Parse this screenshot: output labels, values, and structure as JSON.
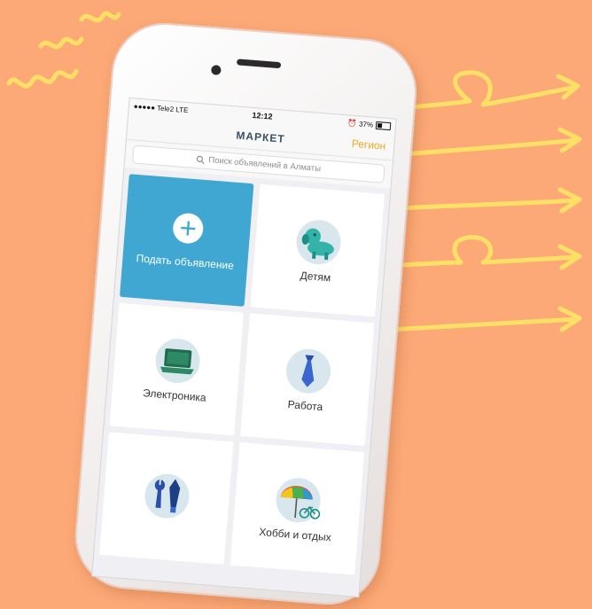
{
  "status_bar": {
    "carrier": "●●●●● Tele2",
    "network": "LTE",
    "time": "12:12",
    "battery": "37%"
  },
  "header": {
    "title": "МАРКЕТ",
    "region_label": "Регион"
  },
  "search": {
    "placeholder": "Поиск объявлений в Алматы"
  },
  "categories": [
    {
      "label": "Подать объявление",
      "icon": "plus-icon"
    },
    {
      "label": "Детям",
      "icon": "toy-dog-icon"
    },
    {
      "label": "Электроника",
      "icon": "laptop-icon"
    },
    {
      "label": "Работа",
      "icon": "tie-icon"
    },
    {
      "label": "",
      "icon": "tools-icon"
    },
    {
      "label": "Хобби и отдых",
      "icon": "umbrella-bicycle-icon"
    }
  ],
  "colors": {
    "background": "#FCA977",
    "accent": "#40A7D3",
    "region": "#F5A623",
    "decoration": "#FFE066"
  }
}
